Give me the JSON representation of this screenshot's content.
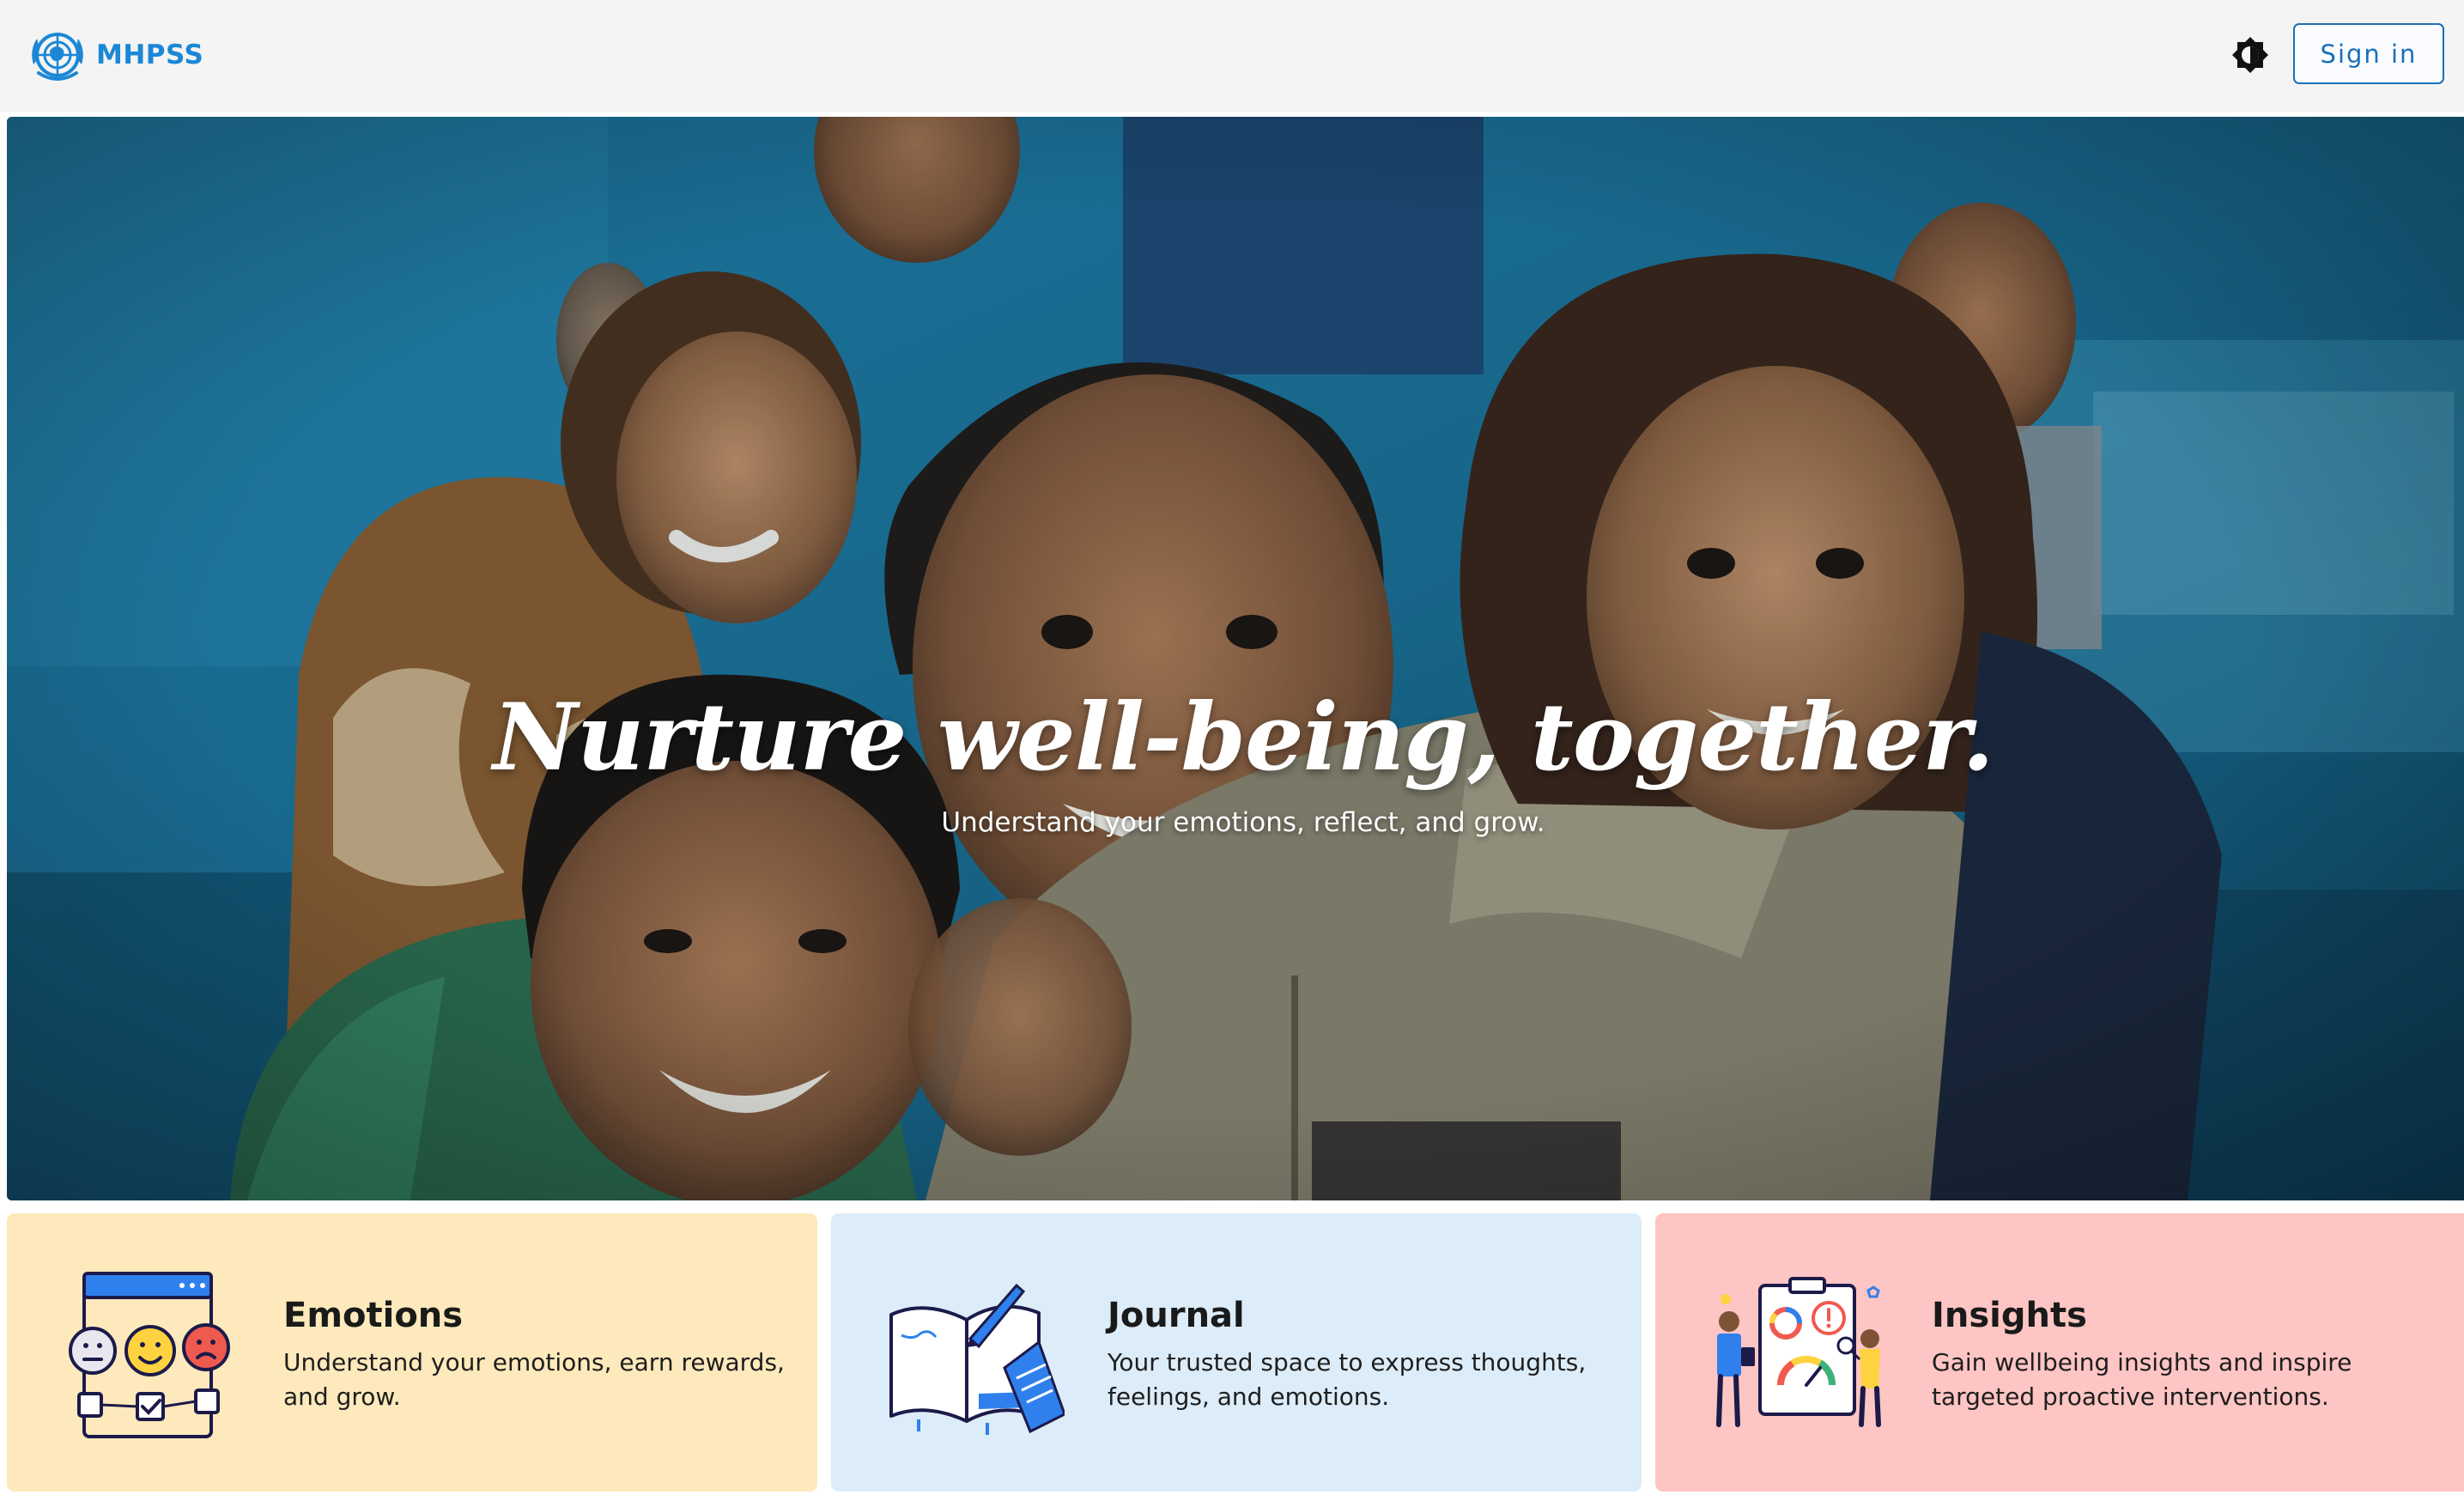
{
  "header": {
    "brand_name": "MHPSS",
    "signin_label": "Sign in",
    "logo_icon": "un-emblem-icon",
    "theme_icon": "brightness-icon"
  },
  "hero": {
    "title": "Nurture well-being, together.",
    "subtitle": "Understand your emotions, reflect, and grow."
  },
  "cards": [
    {
      "title": "Emotions",
      "description": "Understand your emotions, earn rewards, and grow.",
      "icon": "emotion-faces-icon"
    },
    {
      "title": "Journal",
      "description": "Your trusted space to express thoughts, feelings, and emotions.",
      "icon": "journal-notebook-icon"
    },
    {
      "title": "Insights",
      "description": "Gain wellbeing insights and inspire targeted proactive interventions.",
      "icon": "analytics-dashboard-icon"
    }
  ],
  "colors": {
    "brand": "#1b87d6",
    "header_bg": "#f4f4f4",
    "emotions_card": "#fde9bb",
    "journal_card": "#dcecf8",
    "insights_card": "#fdc5c3"
  }
}
